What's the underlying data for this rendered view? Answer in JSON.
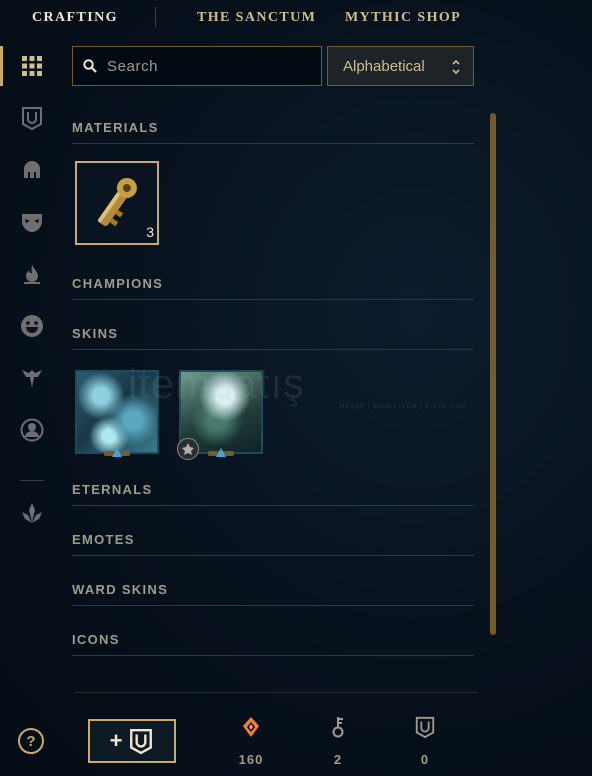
{
  "nav": {
    "tabs": [
      {
        "label": "CRAFTING",
        "active": true
      },
      {
        "label": "THE SANCTUM",
        "active": false
      },
      {
        "label": "MYTHIC SHOP",
        "active": false
      }
    ]
  },
  "sidebar": {
    "items": [
      {
        "icon": "grid-icon",
        "active": true
      },
      {
        "icon": "chest-icon"
      },
      {
        "icon": "helmet-icon"
      },
      {
        "icon": "mask-icon"
      },
      {
        "icon": "flame-icon"
      },
      {
        "icon": "smiley-icon"
      },
      {
        "icon": "ward-icon"
      },
      {
        "icon": "profile-icon"
      },
      {
        "icon": "arrow-down-icon"
      }
    ],
    "help_label": "?"
  },
  "search": {
    "placeholder": "Search",
    "value": ""
  },
  "sort": {
    "selected": "Alphabetical"
  },
  "sections": {
    "materials": "MATERIALS",
    "champions": "CHAMPIONS",
    "skins": "SKINS",
    "eternals": "ETERNALS",
    "emotes": "EMOTES",
    "ward_skins": "WARD SKINS",
    "icons": "ICONS"
  },
  "materials": [
    {
      "icon": "key-fragment-icon",
      "count": "3"
    }
  ],
  "skins": [
    {
      "icon": "skin-shard-icon",
      "rarity_color": "#3da5e0"
    },
    {
      "icon": "skin-shard-icon",
      "rarity_color": "#3da5e0",
      "badge": "mythic-badge-icon"
    }
  ],
  "watermark": {
    "text": "itemsatış",
    "sub": "HESAP | SKIN | ITEM | E-PIN  .com"
  },
  "footer": {
    "craft_plus": "+",
    "currencies": [
      {
        "icon": "orange-essence-icon",
        "value": "160",
        "color": "#f0813c"
      },
      {
        "icon": "key-icon",
        "value": "2"
      },
      {
        "icon": "chest-icon",
        "value": "0"
      }
    ]
  },
  "colors": {
    "gold": "#c8aa6e",
    "bg": "#07111c",
    "text": "#a09b8c"
  }
}
